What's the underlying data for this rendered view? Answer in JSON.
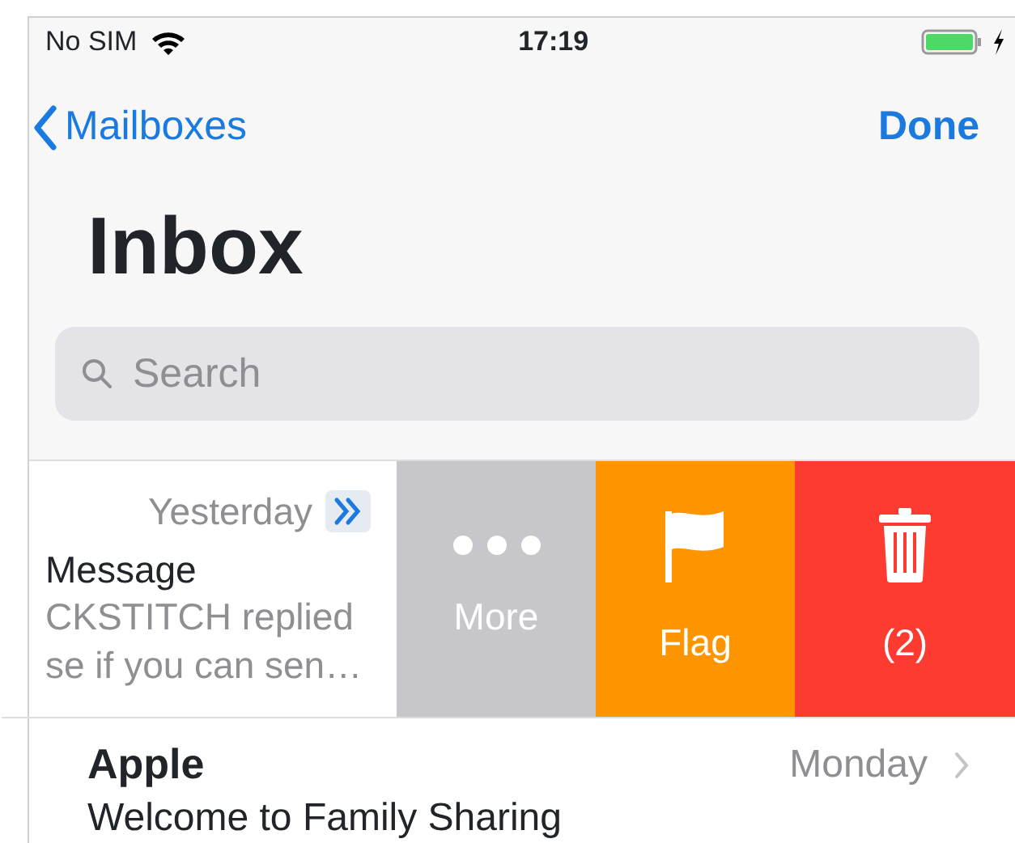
{
  "status_bar": {
    "carrier": "No SIM",
    "time": "17:19"
  },
  "nav": {
    "back": "Mailboxes",
    "action": "Done"
  },
  "title": "Inbox",
  "search": {
    "placeholder": "Search"
  },
  "messages": [
    {
      "kind": "swiped",
      "date": "Yesterday",
      "sender": "Message",
      "preview_lines": [
        "CKSTITCH replied",
        "se if you can sen…"
      ],
      "actions": [
        {
          "kind": "more",
          "label": "More"
        },
        {
          "kind": "flag",
          "label": "Flag"
        },
        {
          "kind": "trash",
          "label": "(2)"
        }
      ]
    },
    {
      "kind": "normal",
      "date": "Monday",
      "sender": "Apple",
      "preview_lines": [
        "Welcome to Family Sharing"
      ]
    }
  ]
}
